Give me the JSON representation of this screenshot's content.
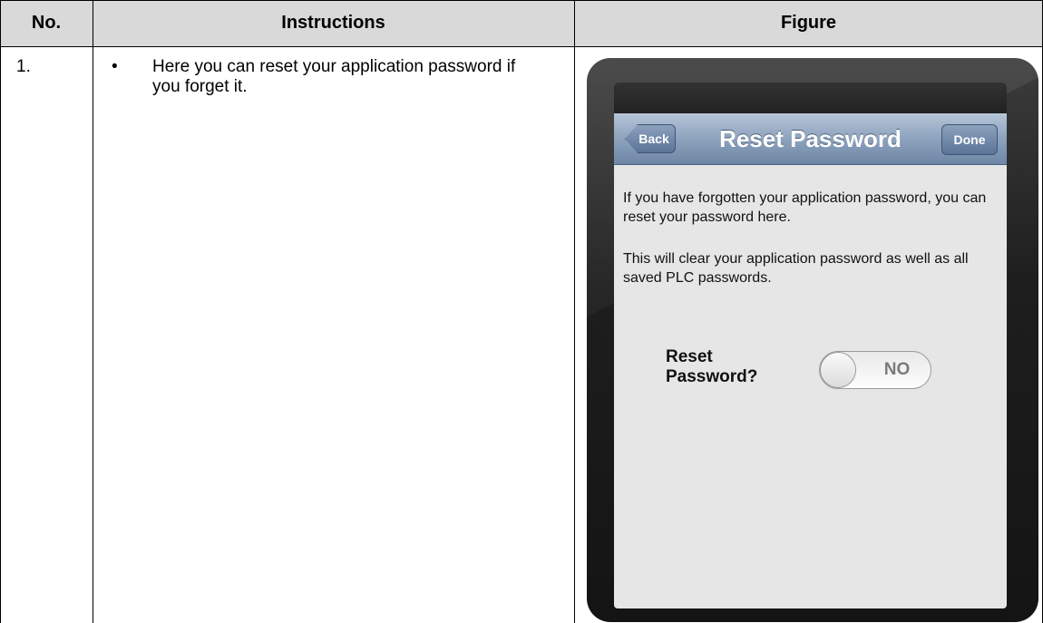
{
  "table": {
    "headers": {
      "no": "No.",
      "instructions": "Instructions",
      "figure": "Figure"
    },
    "rows": [
      {
        "no": "1.",
        "bullet": "•",
        "instruction": "Here you can reset your application password if you forget it."
      }
    ]
  },
  "figure": {
    "navbar": {
      "back_label": "Back",
      "title": "Reset Password",
      "done_label": "Done"
    },
    "body": {
      "paragraph1": "If you have forgotten your application password, you can reset your password here.",
      "paragraph2": "This will clear your application password as well as all saved PLC passwords."
    },
    "reset": {
      "label": "Reset Password?",
      "toggle_value": "NO"
    }
  },
  "colors": {
    "header_bg": "#d9d9d9",
    "navbar_top": "#b7c6d8",
    "navbar_bottom": "#6e87a6",
    "screen_bg": "#e6e6e6",
    "device_bezel": "#1e1e1e"
  }
}
